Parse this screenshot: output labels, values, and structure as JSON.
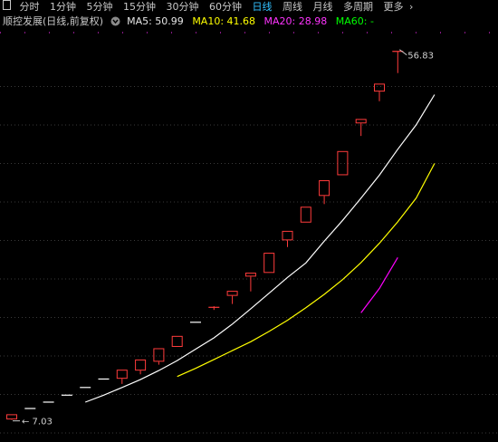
{
  "toolbar": {
    "window_icon": "window-icon",
    "tabs": [
      "分时",
      "1分钟",
      "5分钟",
      "15分钟",
      "30分钟",
      "60分钟",
      "日线",
      "周线",
      "月线",
      "多周期",
      "更多"
    ],
    "selected_tab": "日线",
    "more_arrow": "›"
  },
  "info": {
    "stock_title": "顺控发展(日线,前复权)",
    "ma5_label": "MA5: 50.99",
    "ma10_label": "MA10: 41.68",
    "ma20_label": "MA20: 28.98",
    "ma60_label": "MA60: -",
    "colors": {
      "ma5": "#ffffff",
      "ma10": "#ffff00",
      "ma20": "#ff00ff",
      "ma60": "#00ff00"
    }
  },
  "chart_data": {
    "type": "candlestick",
    "high_label": "56.83",
    "low_label": "7.03",
    "x": [
      0,
      1,
      2,
      3,
      4,
      5,
      6,
      7,
      8,
      9,
      10,
      11,
      12,
      13,
      14,
      15,
      16,
      17,
      18,
      19,
      20,
      21
    ],
    "candles": [
      {
        "o": 7.1,
        "c": 7.8,
        "h": 7.8,
        "l": 7.03
      },
      {
        "o": 8.58,
        "c": 8.58,
        "h": 8.58,
        "l": 8.58
      },
      {
        "o": 9.44,
        "c": 9.44,
        "h": 9.44,
        "l": 9.44
      },
      {
        "o": 10.38,
        "c": 10.38,
        "h": 10.38,
        "l": 10.38
      },
      {
        "o": 11.42,
        "c": 11.42,
        "h": 11.42,
        "l": 11.42
      },
      {
        "o": 12.56,
        "c": 12.56,
        "h": 12.56,
        "l": 12.56
      },
      {
        "o": 12.6,
        "c": 13.82,
        "h": 13.82,
        "l": 11.9
      },
      {
        "o": 13.7,
        "c": 15.2,
        "h": 15.2,
        "l": 13.2
      },
      {
        "o": 14.9,
        "c": 16.72,
        "h": 16.72,
        "l": 14.5
      },
      {
        "o": 16.9,
        "c": 18.39,
        "h": 18.39,
        "l": 16.9
      },
      {
        "o": 20.23,
        "c": 20.23,
        "h": 20.23,
        "l": 20.23
      },
      {
        "o": 22.25,
        "c": 22.25,
        "h": 22.4,
        "l": 21.9
      },
      {
        "o": 23.8,
        "c": 24.48,
        "h": 24.48,
        "l": 22.7
      },
      {
        "o": 26.4,
        "c": 26.93,
        "h": 26.93,
        "l": 24.4
      },
      {
        "o": 26.9,
        "c": 29.62,
        "h": 29.62,
        "l": 26.9
      },
      {
        "o": 31.3,
        "c": 32.58,
        "h": 32.58,
        "l": 30.4
      },
      {
        "o": 33.7,
        "c": 35.84,
        "h": 35.84,
        "l": 33.7
      },
      {
        "o": 37.3,
        "c": 39.42,
        "h": 39.42,
        "l": 36.2
      },
      {
        "o": 40.1,
        "c": 43.36,
        "h": 43.36,
        "l": 40.1
      },
      {
        "o": 47.1,
        "c": 47.7,
        "h": 47.7,
        "l": 45.4
      },
      {
        "o": 51.4,
        "c": 52.47,
        "h": 52.47,
        "l": 50.1
      },
      {
        "o": 56.83,
        "c": 56.83,
        "h": 56.83,
        "l": 53.9
      }
    ],
    "ma5": {
      "start": 4,
      "values": [
        9.44,
        10.38,
        11.42,
        12.49,
        13.71,
        15.06,
        16.6,
        18.13,
        19.98,
        22.06,
        24.16,
        26.29,
        28.25,
        31.18,
        34.0,
        37.0,
        40.1,
        43.6,
        46.9,
        50.99
      ]
    },
    "ma10": {
      "start": 9,
      "values": [
        12.9,
        14.0,
        15.2,
        16.4,
        17.6,
        19.0,
        20.5,
        22.2,
        24.0,
        26.0,
        28.3,
        30.9,
        33.8,
        37.0,
        41.68
      ]
    },
    "ma20": {
      "start": 19,
      "values": [
        21.5,
        24.8,
        28.98
      ]
    },
    "ylim": [
      6.5,
      59
    ]
  }
}
